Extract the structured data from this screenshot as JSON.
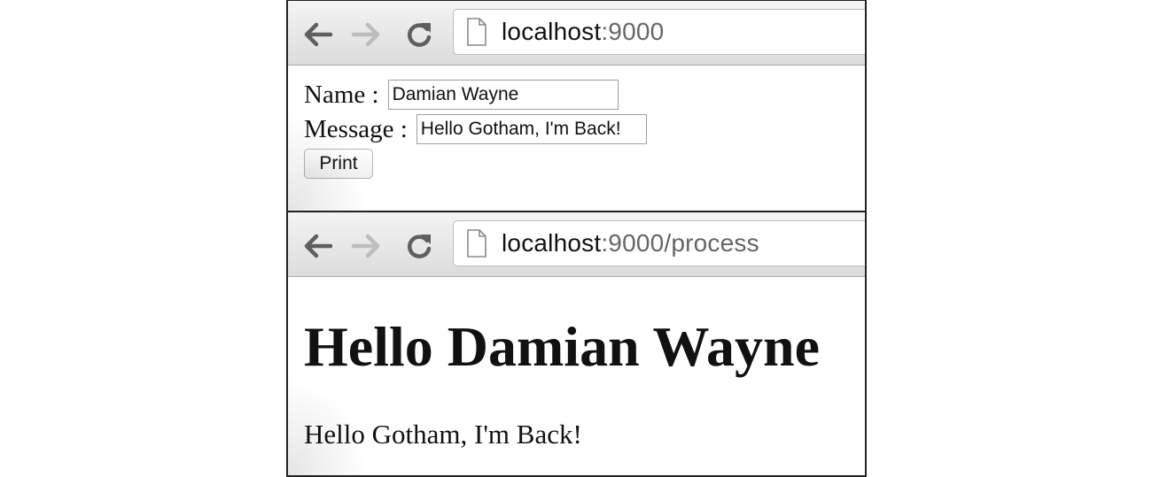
{
  "windows": [
    {
      "url_host": "localhost",
      "url_rest": ":9000",
      "form": {
        "name_label": "Name :",
        "name_value": "Damian Wayne",
        "message_label": "Message :",
        "message_value": "Hello Gotham, I'm Back!",
        "print_label": "Print"
      }
    },
    {
      "url_host": "localhost",
      "url_rest": ":9000/process",
      "result": {
        "heading": "Hello Damian Wayne",
        "message": "Hello Gotham, I'm Back!"
      }
    }
  ],
  "icons": {
    "back": "back-arrow-icon",
    "forward": "forward-arrow-icon",
    "reload": "reload-icon",
    "page": "page-icon"
  },
  "colors": {
    "toolbar_top": "#f4f4f4",
    "toolbar_bottom": "#dcdcdc",
    "url_host": "#111111",
    "url_rest": "#666666",
    "forward_disabled": "#bdbdbd",
    "frame_border": "#222222"
  }
}
